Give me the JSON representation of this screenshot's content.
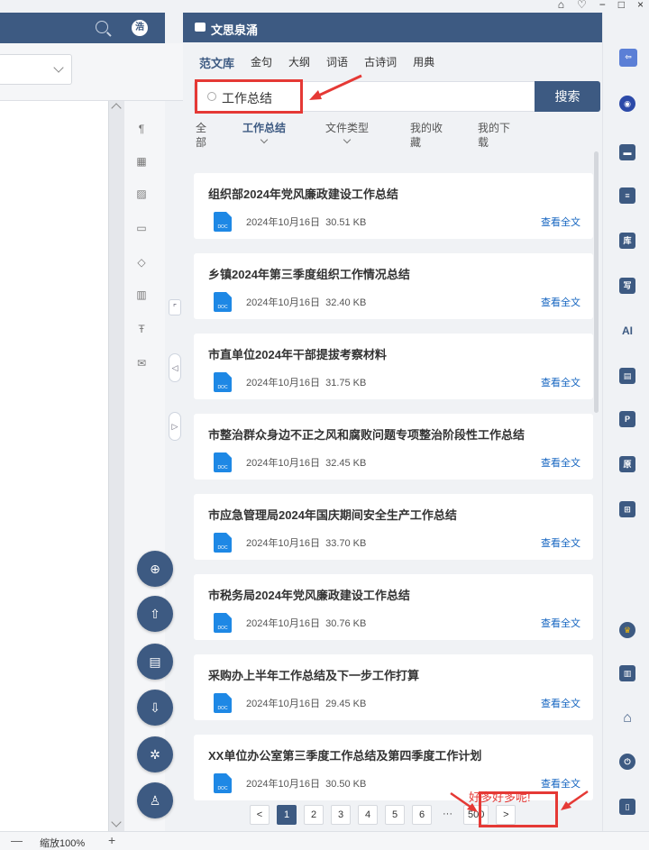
{
  "window_controls": [
    "⌂",
    "♡",
    "−",
    "□",
    "×"
  ],
  "left": {
    "avatar_text": "浩",
    "zoom_minus": "—",
    "zoom_label": "缩放100%",
    "zoom_plus": "+"
  },
  "panel": {
    "title": "文思泉涌",
    "tabs": [
      "范文库",
      "金句",
      "大纲",
      "词语",
      "古诗词",
      "用典"
    ],
    "search": {
      "value": "工作总结",
      "button": "搜索"
    },
    "filters": {
      "all": "全\n部",
      "work_summary": "工作总结",
      "file_type": "文件类型",
      "my_fav": "我的收\n藏",
      "my_dl": "我的下\n载"
    },
    "items": [
      {
        "title": "组织部2024年党风廉政建设工作总结",
        "date": "2024年10月16日",
        "size": "30.51 KB",
        "link": "查看全文"
      },
      {
        "title": "乡镇2024年第三季度组织工作情况总结",
        "date": "2024年10月16日",
        "size": "32.40 KB",
        "link": "查看全文"
      },
      {
        "title": "市直单位2024年干部提拔考察材料",
        "date": "2024年10月16日",
        "size": "31.75 KB",
        "link": "查看全文"
      },
      {
        "title": "市整治群众身边不正之风和腐败问题专项整治阶段性工作总结",
        "date": "2024年10月16日",
        "size": "32.45 KB",
        "link": "查看全文"
      },
      {
        "title": "市应急管理局2024年国庆期间安全生产工作总结",
        "date": "2024年10月16日",
        "size": "33.70 KB",
        "link": "查看全文"
      },
      {
        "title": "市税务局2024年党风廉政建设工作总结",
        "date": "2024年10月16日",
        "size": "30.76 KB",
        "link": "查看全文"
      },
      {
        "title": "采购办上半年工作总结及下一步工作打算",
        "date": "2024年10月16日",
        "size": "29.45 KB",
        "link": "查看全文"
      },
      {
        "title": "XX单位办公室第三季度工作总结及第四季度工作计划",
        "date": "2024年10月16日",
        "size": "30.50 KB",
        "link": "查看全文"
      }
    ],
    "doc_icon_label": "DOC",
    "pager": {
      "prev": "<",
      "pages": [
        "1",
        "2",
        "3",
        "4",
        "5",
        "6"
      ],
      "dots": "···",
      "last": "500",
      "next": ">"
    },
    "annotation": "好多好多呢!"
  },
  "colors": {
    "brand": "#3d5a82",
    "annotation": "#e53935",
    "link": "#1565c0"
  }
}
